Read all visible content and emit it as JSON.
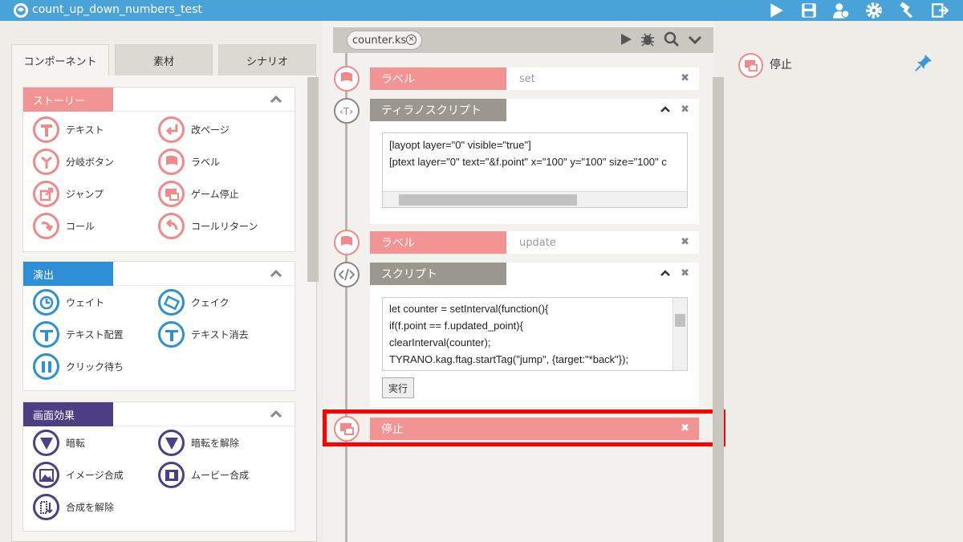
{
  "titlebar": {
    "title": "count_up_down_numbers_test",
    "icons": [
      "play-icon",
      "save-icon",
      "users-icon",
      "gear-icon",
      "build-icon",
      "exit-icon"
    ]
  },
  "left": {
    "tabs": [
      "コンポーネント",
      "素材",
      "シナリオ"
    ],
    "sections": [
      {
        "label": "ストーリー",
        "color": "#f39494",
        "items": [
          "テキスト",
          "改ページ",
          "分岐ボタン",
          "ラベル",
          "ジャンプ",
          "ゲーム停止",
          "コール",
          "コールリターン"
        ]
      },
      {
        "label": "演出",
        "color": "#2d8fd6",
        "items": [
          "ウェイト",
          "クェイク",
          "テキスト配置",
          "テキスト消去",
          "クリック待ち"
        ]
      },
      {
        "label": "画面効果",
        "color": "#4c3f86",
        "items": [
          "暗転",
          "暗転を解除",
          "イメージ合成",
          "ムービー合成",
          "合成を解除"
        ]
      }
    ]
  },
  "editor": {
    "file_tab": "counter.ks",
    "rows": [
      {
        "type": "ラベル",
        "value": "set"
      },
      {
        "type": "ティラノスクリプト",
        "code": [
          "[layopt layer=\"0\" visible=\"true\"]",
          "[ptext layer=\"0\" text=\"&f.point\" x=\"100\" y=\"100\" size=\"100\" c"
        ]
      },
      {
        "type": "ラベル",
        "value": "update"
      },
      {
        "type": "スクリプト",
        "code": [
          "let counter = setInterval(function(){",
          "if(f.point == f.updated_point){",
          "clearInterval(counter);",
          "TYRANO.kag.ftag.startTag(\"jump\", {target:\"*back\"});"
        ],
        "run": "実行"
      },
      {
        "type": "停止"
      }
    ]
  },
  "right": {
    "item": "停止"
  }
}
